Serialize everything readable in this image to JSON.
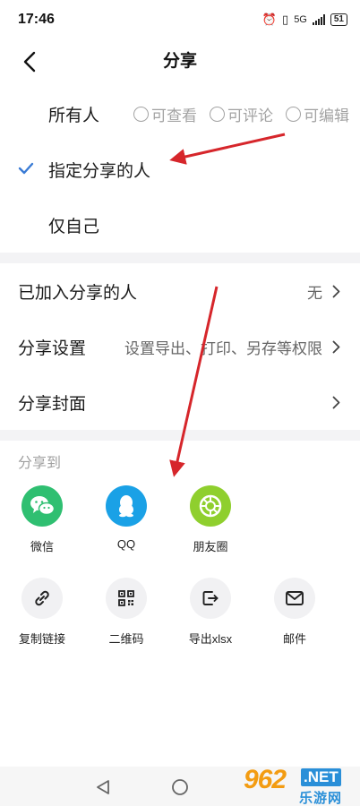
{
  "status_bar": {
    "time": "17:46",
    "network": "5G",
    "battery": "51"
  },
  "nav": {
    "title": "分享"
  },
  "visibility": {
    "options": [
      {
        "label": "所有人",
        "selected": false
      },
      {
        "label": "指定分享的人",
        "selected": true
      },
      {
        "label": "仅自己",
        "selected": false
      }
    ],
    "permissions": [
      "可查看",
      "可评论",
      "可编辑"
    ]
  },
  "settings": [
    {
      "label": "已加入分享的人",
      "value": "无"
    },
    {
      "label": "分享设置",
      "value": "设置导出、打印、另存等权限"
    },
    {
      "label": "分享封面",
      "value": ""
    }
  ],
  "share_to": {
    "title": "分享到",
    "apps": [
      "微信",
      "QQ",
      "朋友圈"
    ],
    "tools": [
      "复制链接",
      "二维码",
      "导出xlsx",
      "邮件"
    ]
  },
  "watermark": {
    "number": "962",
    "suffix": ".NET",
    "site": "乐游网"
  },
  "colors": {
    "accent": "#3a7bd5",
    "wechat": "#2fbf71",
    "qq": "#1aa1e6",
    "moments": "#8fcf2e",
    "annotation_arrow": "#d6262b"
  }
}
